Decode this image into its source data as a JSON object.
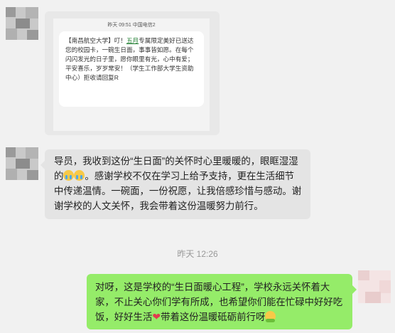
{
  "colors": {
    "background": "#f1f1f1",
    "incoming_bubble": "#e4e4e4",
    "outgoing_bubble": "#95ec69"
  },
  "messages": [
    {
      "direction": "incoming",
      "type": "image",
      "screenshot": {
        "status_bar": "昨天 09:51  中国电信2",
        "sms_before_link": "【南昌航空大学】叮！",
        "sms_link": "五月",
        "sms_after_link": "专属限定美好已送达您的校园卡，一碗生日面，事事皆如愿。在每个闪闪发光的日子里，愿你眼里有光，心中有爱；平安喜乐，岁岁常安！（学生工作部大学生资助中心）拒收请回复R"
      }
    },
    {
      "direction": "incoming",
      "type": "text",
      "text_part1": "导员，我收到这份“生日面”的关怀时心里暖暖的，眼眶湿湿的",
      "emoji": "crying-face",
      "text_part2": "。感谢学校不仅在学习上给予支持，更在生活细节中传递温情。一碗面，一份祝愿，让我倍感珍惜与感动。谢谢学校的人文关怀，我会带着这份温暖努力前行。"
    },
    {
      "direction": "outgoing",
      "type": "text",
      "text_part1": "对呀，这是学校的“生日面暖心工程”，学校永远关怀着大家，不止关心你们学有所成，也希望你们能在忙碌中好好吃饭，好好生活",
      "emoji_heart": "❤",
      "text_part2": "带着这份温暖砥砺前行呀",
      "emoji_end": "hugging-face"
    }
  ],
  "timestamp": "昨天 12:26"
}
